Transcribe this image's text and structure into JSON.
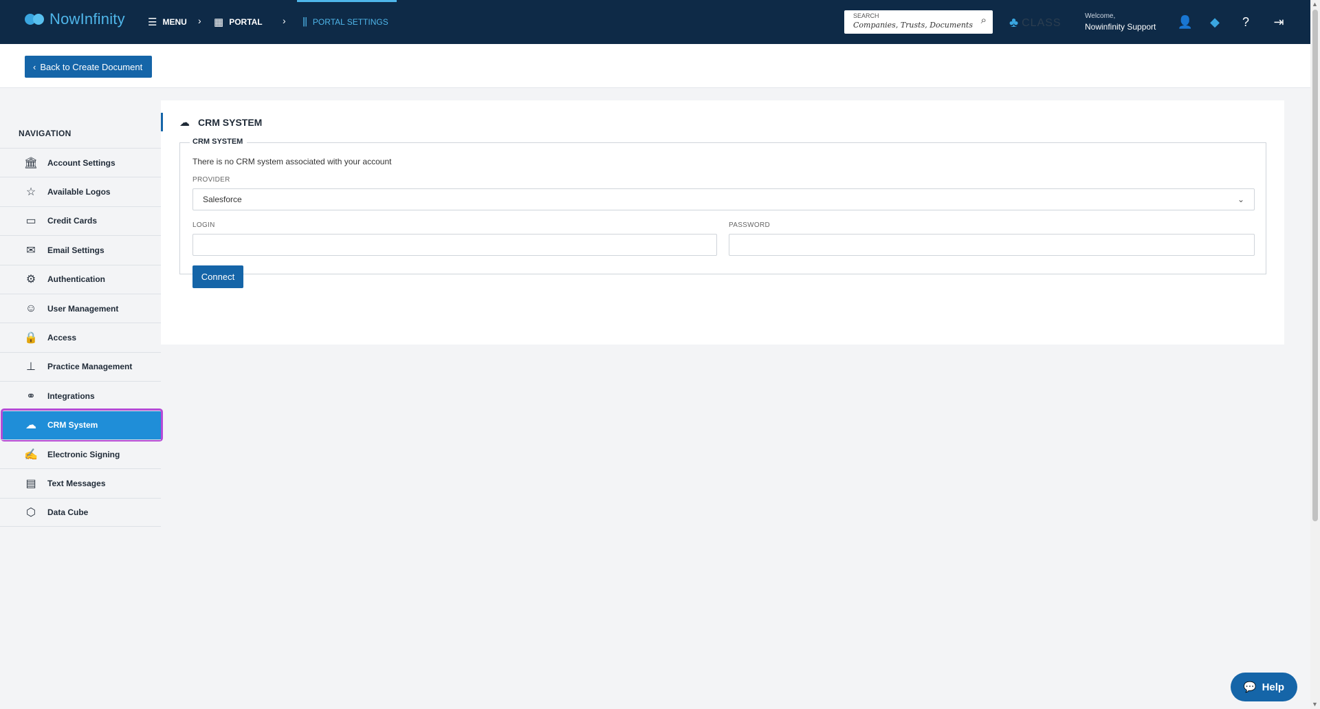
{
  "header": {
    "logo_text": "NowInfinity",
    "menu_label": "MENU",
    "portal_label": "PORTAL",
    "portal_settings_label": "PORTAL SETTINGS",
    "search_label": "SEARCH",
    "search_placeholder": "Companies,  Trusts,  Documents",
    "class_logo": "CLASS",
    "welcome_label": "Welcome,",
    "user_name": "Nowinfinity Support"
  },
  "subbar": {
    "back_label": "Back to Create Document"
  },
  "sidebar": {
    "title": "NAVIGATION",
    "items": [
      {
        "label": "Account Settings",
        "icon": "bank-icon"
      },
      {
        "label": "Available Logos",
        "icon": "star-icon"
      },
      {
        "label": "Credit Cards",
        "icon": "credit-card-icon"
      },
      {
        "label": "Email Settings",
        "icon": "email-icon"
      },
      {
        "label": "Authentication",
        "icon": "gear-icon"
      },
      {
        "label": "User Management",
        "icon": "user-icon"
      },
      {
        "label": "Access",
        "icon": "lock-icon"
      },
      {
        "label": "Practice Management",
        "icon": "org-chart-icon"
      },
      {
        "label": "Integrations",
        "icon": "link-icon"
      },
      {
        "label": "CRM System",
        "icon": "cloud-icon",
        "active": true
      },
      {
        "label": "Electronic Signing",
        "icon": "signing-icon"
      },
      {
        "label": "Text Messages",
        "icon": "message-icon"
      },
      {
        "label": "Data Cube",
        "icon": "cube-icon"
      }
    ]
  },
  "main": {
    "title": "CRM SYSTEM",
    "section_legend": "CRM SYSTEM",
    "message": "There is no CRM system associated with your account",
    "provider_label": "PROVIDER",
    "provider_value": "Salesforce",
    "login_label": "LOGIN",
    "login_value": "",
    "password_label": "PASSWORD",
    "password_value": "",
    "connect_label": "Connect"
  },
  "help_label": "Help",
  "colors": {
    "topbar": "#0e2a47",
    "accent": "#1565a8",
    "active_nav": "#1f8ed8",
    "highlight": "#b64bd6"
  }
}
